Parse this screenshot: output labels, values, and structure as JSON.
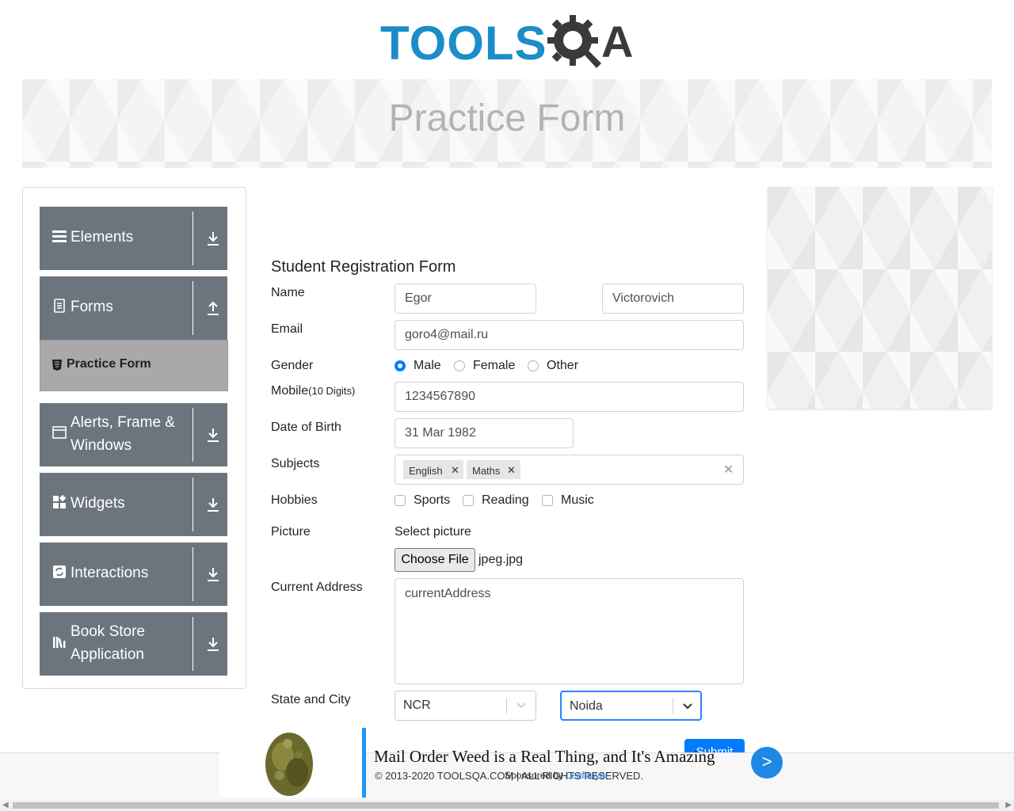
{
  "header": {
    "logo_text": "TOOLS",
    "logo_suffix": "A",
    "page_title": "Practice Form"
  },
  "sidebar": {
    "groups": [
      {
        "label": "Elements",
        "icon": "menu-icon",
        "arrow": "download-icon"
      },
      {
        "label": "Forms",
        "icon": "document-icon",
        "arrow": "upload-icon"
      },
      {
        "label": "Alerts, Frame & Windows",
        "icon": "window-icon",
        "arrow": "download-icon"
      },
      {
        "label": "Widgets",
        "icon": "widgets-icon",
        "arrow": "download-icon"
      },
      {
        "label": "Interactions",
        "icon": "interactions-icon",
        "arrow": "download-icon"
      },
      {
        "label": "Book Store Application",
        "icon": "books-icon",
        "arrow": "download-icon"
      }
    ],
    "active_item": "Practice Form"
  },
  "form": {
    "title": "Student Registration Form",
    "name_label": "Name",
    "first_name": "Egor",
    "last_name": "Victorovich",
    "email_label": "Email",
    "email": "goro4@mail.ru",
    "gender_label": "Gender",
    "gender_options": [
      "Male",
      "Female",
      "Other"
    ],
    "gender_selected": "Male",
    "mobile_label": "Mobile",
    "mobile_hint": "(10 Digits)",
    "mobile": "1234567890",
    "dob_label": "Date of Birth",
    "dob": "31 Mar 1982",
    "subjects_label": "Subjects",
    "subjects": [
      "English",
      "Maths"
    ],
    "hobbies_label": "Hobbies",
    "hobbies": [
      "Sports",
      "Reading",
      "Music"
    ],
    "picture_label": "Picture",
    "select_picture": "Select picture",
    "choose_file": "Choose File",
    "file_name": "jpeg.jpg",
    "address_label": "Current Address",
    "address": "currentAddress",
    "state_city_label": "State and City",
    "state": "NCR",
    "city": "Noida",
    "submit": "Submit"
  },
  "footer": {
    "copyright": "© 2013-2020 TOOLSQA.COM | ALL RIGHTS RESERVED."
  },
  "advert": {
    "title": "Mail Order Weed is a Real Thing, and It's Amazing",
    "sponsored_by": "Sponsored by",
    "sponsor": "Leafbuyer",
    "go": ">"
  },
  "colors": {
    "primary": "#007bff",
    "sidebar_group": "#6c757d",
    "active_item": "#a9a9a9",
    "logo_blue": "#1b8dc8"
  }
}
